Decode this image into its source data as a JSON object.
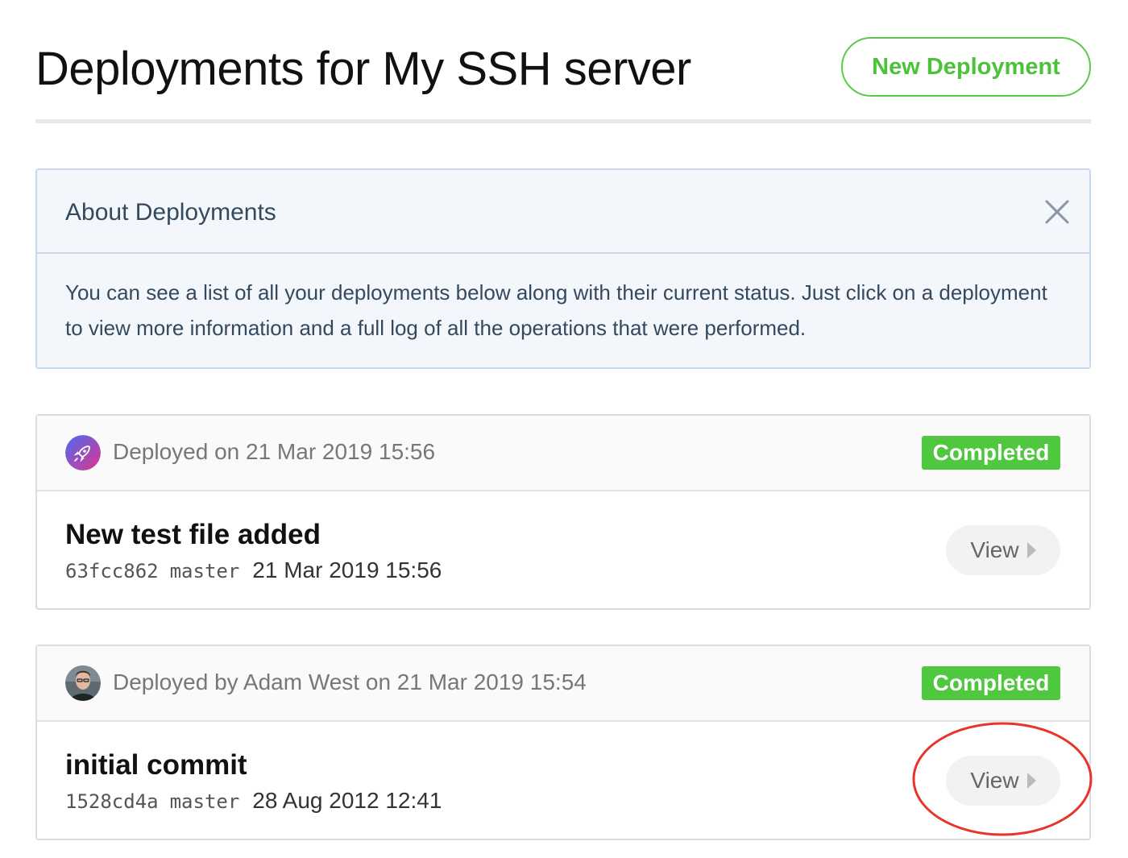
{
  "header": {
    "title": "Deployments for My SSH server",
    "new_deployment_label": "New Deployment"
  },
  "about": {
    "title": "About Deployments",
    "body": "You can see a list of all your deployments below along with their current status. Just click on a deployment to view more information and a full log of all the operations that were performed.",
    "close_icon": "close-icon"
  },
  "deployments": [
    {
      "deployed_text": "Deployed on 21 Mar 2019 15:56",
      "avatar_icon": "rocket-icon",
      "status": "Completed",
      "commit_message": "New test file added",
      "commit_hash": "63fcc862",
      "branch": "master",
      "commit_date": "21 Mar 2019 15:56",
      "view_label": "View"
    },
    {
      "deployed_text": "Deployed by Adam West on 21 Mar 2019 15:54",
      "avatar_icon": "user-avatar",
      "status": "Completed",
      "commit_message": "initial commit",
      "commit_hash": "1528cd4a",
      "branch": "master",
      "commit_date": "28 Aug 2012 12:41",
      "view_label": "View"
    }
  ],
  "colors": {
    "accent_green": "#4fc83f",
    "info_bg": "#f3f7fc",
    "info_border": "#c9d9ec",
    "annotation_red": "#e8342b"
  }
}
